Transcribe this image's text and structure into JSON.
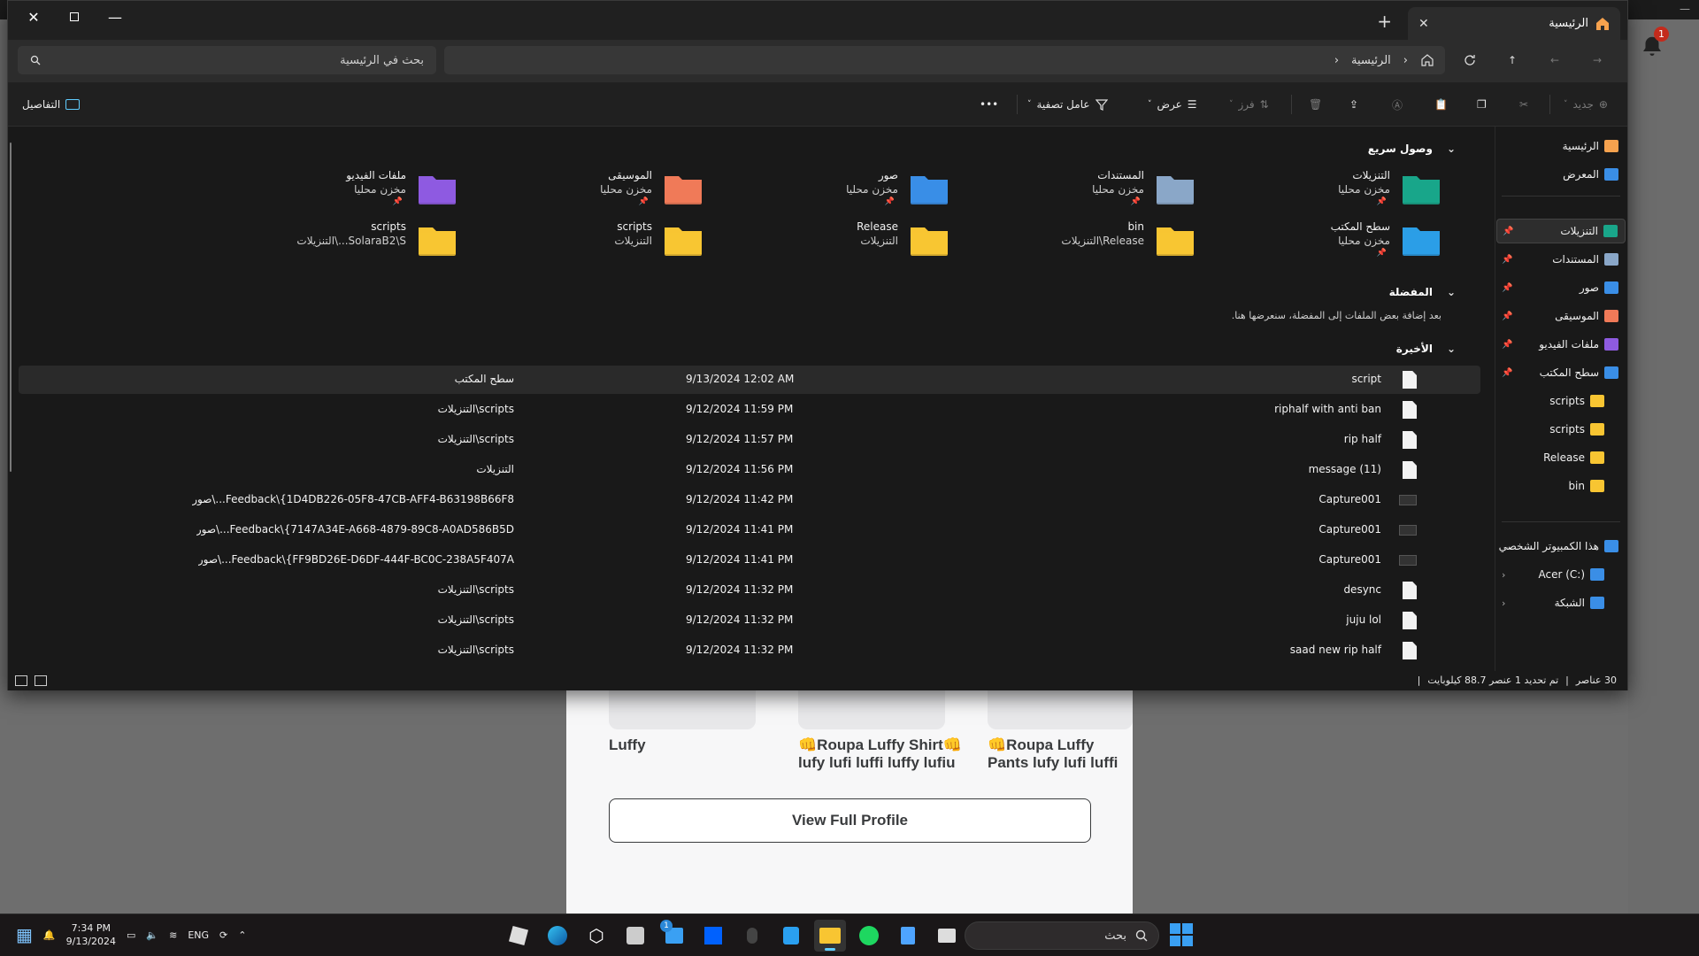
{
  "window": {
    "tab_title": "الرئيسية",
    "search_placeholder": "بحث في الرئيسية",
    "breadcrumb": "الرئيسية"
  },
  "toolbar": {
    "new_label": "جديد",
    "sort_label": "فرز",
    "view_label": "عرض",
    "filter_label": "عامل تصفية",
    "more_label": "•••",
    "details_label": "التفاصيل"
  },
  "quick_access": {
    "title": "وصول سريع",
    "items": [
      {
        "name": "التنزيلات",
        "sub": "مخزن محليا",
        "icon": "downloads-folder-icon",
        "pinned": true
      },
      {
        "name": "المستندات",
        "sub": "مخزن محليا",
        "icon": "documents-folder-icon",
        "pinned": true
      },
      {
        "name": "صور",
        "sub": "مخزن محليا",
        "icon": "pictures-folder-icon",
        "pinned": true
      },
      {
        "name": "الموسيقى",
        "sub": "مخزن محليا",
        "icon": "music-folder-icon",
        "pinned": true
      },
      {
        "name": "ملفات الفيديو",
        "sub": "مخزن محليا",
        "icon": "videos-folder-icon",
        "pinned": true
      },
      {
        "name": "سطح المكتب",
        "sub": "مخزن محليا",
        "icon": "desktop-folder-icon",
        "pinned": true
      },
      {
        "name": "bin",
        "sub": "Release\\التنزيلات",
        "icon": "folder-icon",
        "pinned": false
      },
      {
        "name": "Release",
        "sub": "التنزيلات",
        "icon": "folder-icon",
        "pinned": false
      },
      {
        "name": "scripts",
        "sub": "التنزيلات",
        "icon": "folder-icon",
        "pinned": false
      },
      {
        "name": "scripts",
        "sub": "SolaraB2\\S...\\التنزيلات",
        "icon": "folder-icon",
        "pinned": false
      }
    ]
  },
  "favorites": {
    "title": "المفضلة",
    "empty_message": "بعد إضافة بعض الملفات إلى المفضلة، سنعرضها هنا."
  },
  "recent": {
    "title": "الأخيرة",
    "rows": [
      {
        "name": "script",
        "date": "9/13/2024 12:02 AM",
        "location": "سطح المكتب",
        "type": "file"
      },
      {
        "name": "riphalf with anti ban",
        "date": "9/12/2024 11:59 PM",
        "location": "scripts\\التنزيلات",
        "type": "file"
      },
      {
        "name": "rip half",
        "date": "9/12/2024 11:57 PM",
        "location": "scripts\\التنزيلات",
        "type": "file"
      },
      {
        "name": "message (11)",
        "date": "9/12/2024 11:56 PM",
        "location": "التنزيلات",
        "type": "file"
      },
      {
        "name": "Capture001",
        "date": "9/12/2024 11:42 PM",
        "location": "Feedback\\{1D4DB226-05F8-47CB-AFF4-B63198B66F8...\\صور",
        "type": "image"
      },
      {
        "name": "Capture001",
        "date": "9/12/2024 11:41 PM",
        "location": "Feedback\\{7147A34E-A668-4879-89C8-A0AD586B5D...\\صور",
        "type": "image"
      },
      {
        "name": "Capture001",
        "date": "9/12/2024 11:41 PM",
        "location": "Feedback\\{FF9BD26E-D6DF-444F-BC0C-238A5F407A...\\صور",
        "type": "image"
      },
      {
        "name": "desync",
        "date": "9/12/2024 11:32 PM",
        "location": "scripts\\التنزيلات",
        "type": "file"
      },
      {
        "name": "juju lol",
        "date": "9/12/2024 11:32 PM",
        "location": "scripts\\التنزيلات",
        "type": "file"
      },
      {
        "name": "saad new rip half",
        "date": "9/12/2024 11:32 PM",
        "location": "scripts\\التنزيلات",
        "type": "file"
      }
    ]
  },
  "sidebar": {
    "items": [
      {
        "label": "الرئيسية",
        "icon": "home-icon"
      },
      {
        "label": "المعرض",
        "icon": "gallery-icon"
      },
      {
        "label": "التنزيلات",
        "icon": "downloads-icon",
        "pinned": true,
        "selected": true
      },
      {
        "label": "المستندات",
        "icon": "documents-icon",
        "pinned": true
      },
      {
        "label": "صور",
        "icon": "pictures-icon",
        "pinned": true
      },
      {
        "label": "الموسيقى",
        "icon": "music-icon",
        "pinned": true
      },
      {
        "label": "ملفات الفيديو",
        "icon": "videos-icon",
        "pinned": true
      },
      {
        "label": "سطح المكتب",
        "icon": "desktop-icon",
        "pinned": true
      },
      {
        "label": "scripts",
        "icon": "folder-icon"
      },
      {
        "label": "scripts",
        "icon": "folder-icon"
      },
      {
        "label": "Release",
        "icon": "folder-icon"
      },
      {
        "label": "bin",
        "icon": "folder-icon"
      },
      {
        "label": "هذا الكمبيوتر الشخصي",
        "icon": "this-pc-icon",
        "expanded": true
      },
      {
        "label": "Acer (C:)",
        "icon": "drive-icon"
      },
      {
        "label": "الشبكة",
        "icon": "network-icon"
      }
    ]
  },
  "status": {
    "count": "30 عناصر",
    "selection": "تم تحديد 1 عنصر 88.7 كيلوبايت"
  },
  "background_page": {
    "card_titles": [
      "Luffy",
      "👊Roupa Luffy Shirt👊 lufy lufi luffi luffy lufiu",
      "👊Roupa Luffy Pants lufy lufi luffi luffy lufi"
    ],
    "button": "View Full Profile",
    "notification_count": "1"
  },
  "taskbar": {
    "time": "7:34 PM",
    "date": "9/13/2024",
    "lang": "ENG",
    "search_label": "بحث",
    "store_badge": "1"
  },
  "colors": {
    "folder_yellow": "#f8c532",
    "accent": "#60cdff",
    "window_bg": "#191919"
  }
}
